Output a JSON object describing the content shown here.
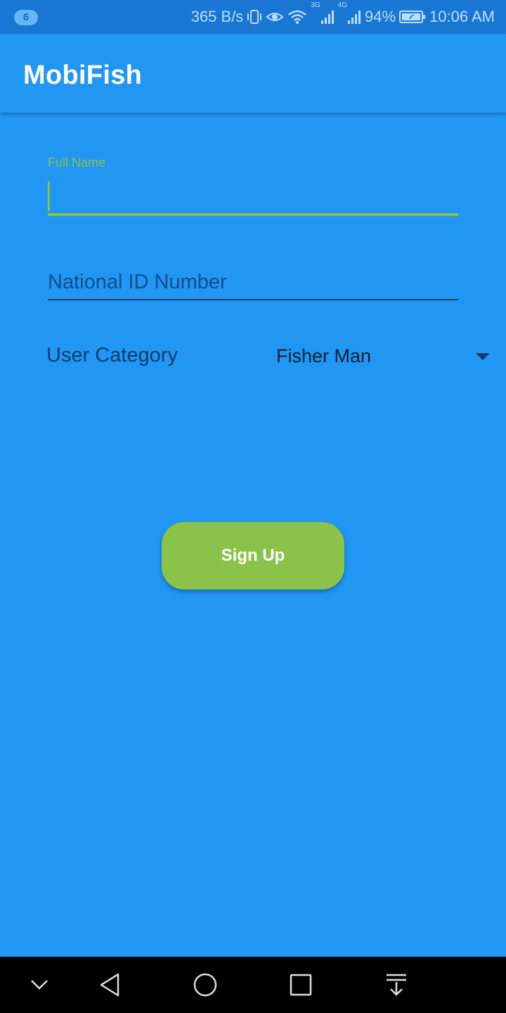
{
  "status_bar": {
    "notification_count": "6",
    "network_speed": "365 B/s",
    "net_3g": "3G",
    "net_4g": "4G",
    "battery": "94%",
    "time": "10:06 AM",
    "icons": [
      "vibrate-icon",
      "eye-icon",
      "wifi-icon",
      "signal-3g-icon",
      "signal-4g-icon",
      "battery-icon"
    ]
  },
  "app_bar": {
    "title": "MobiFish"
  },
  "form": {
    "full_name": {
      "label": "Full Name",
      "value": ""
    },
    "national_id": {
      "placeholder": "National ID Number",
      "value": ""
    },
    "user_category": {
      "label": "User Category",
      "selected": "Fisher Man"
    },
    "submit_label": "Sign Up"
  },
  "nav_bar": {
    "icons": [
      "chevron-down-icon",
      "back-icon",
      "home-icon",
      "recents-icon",
      "pull-down-icon"
    ]
  },
  "colors": {
    "primary": "#2196F3",
    "status_bar": "#1976D2",
    "accent": "#8BC34A",
    "text_dark": "#0D3C6E"
  }
}
